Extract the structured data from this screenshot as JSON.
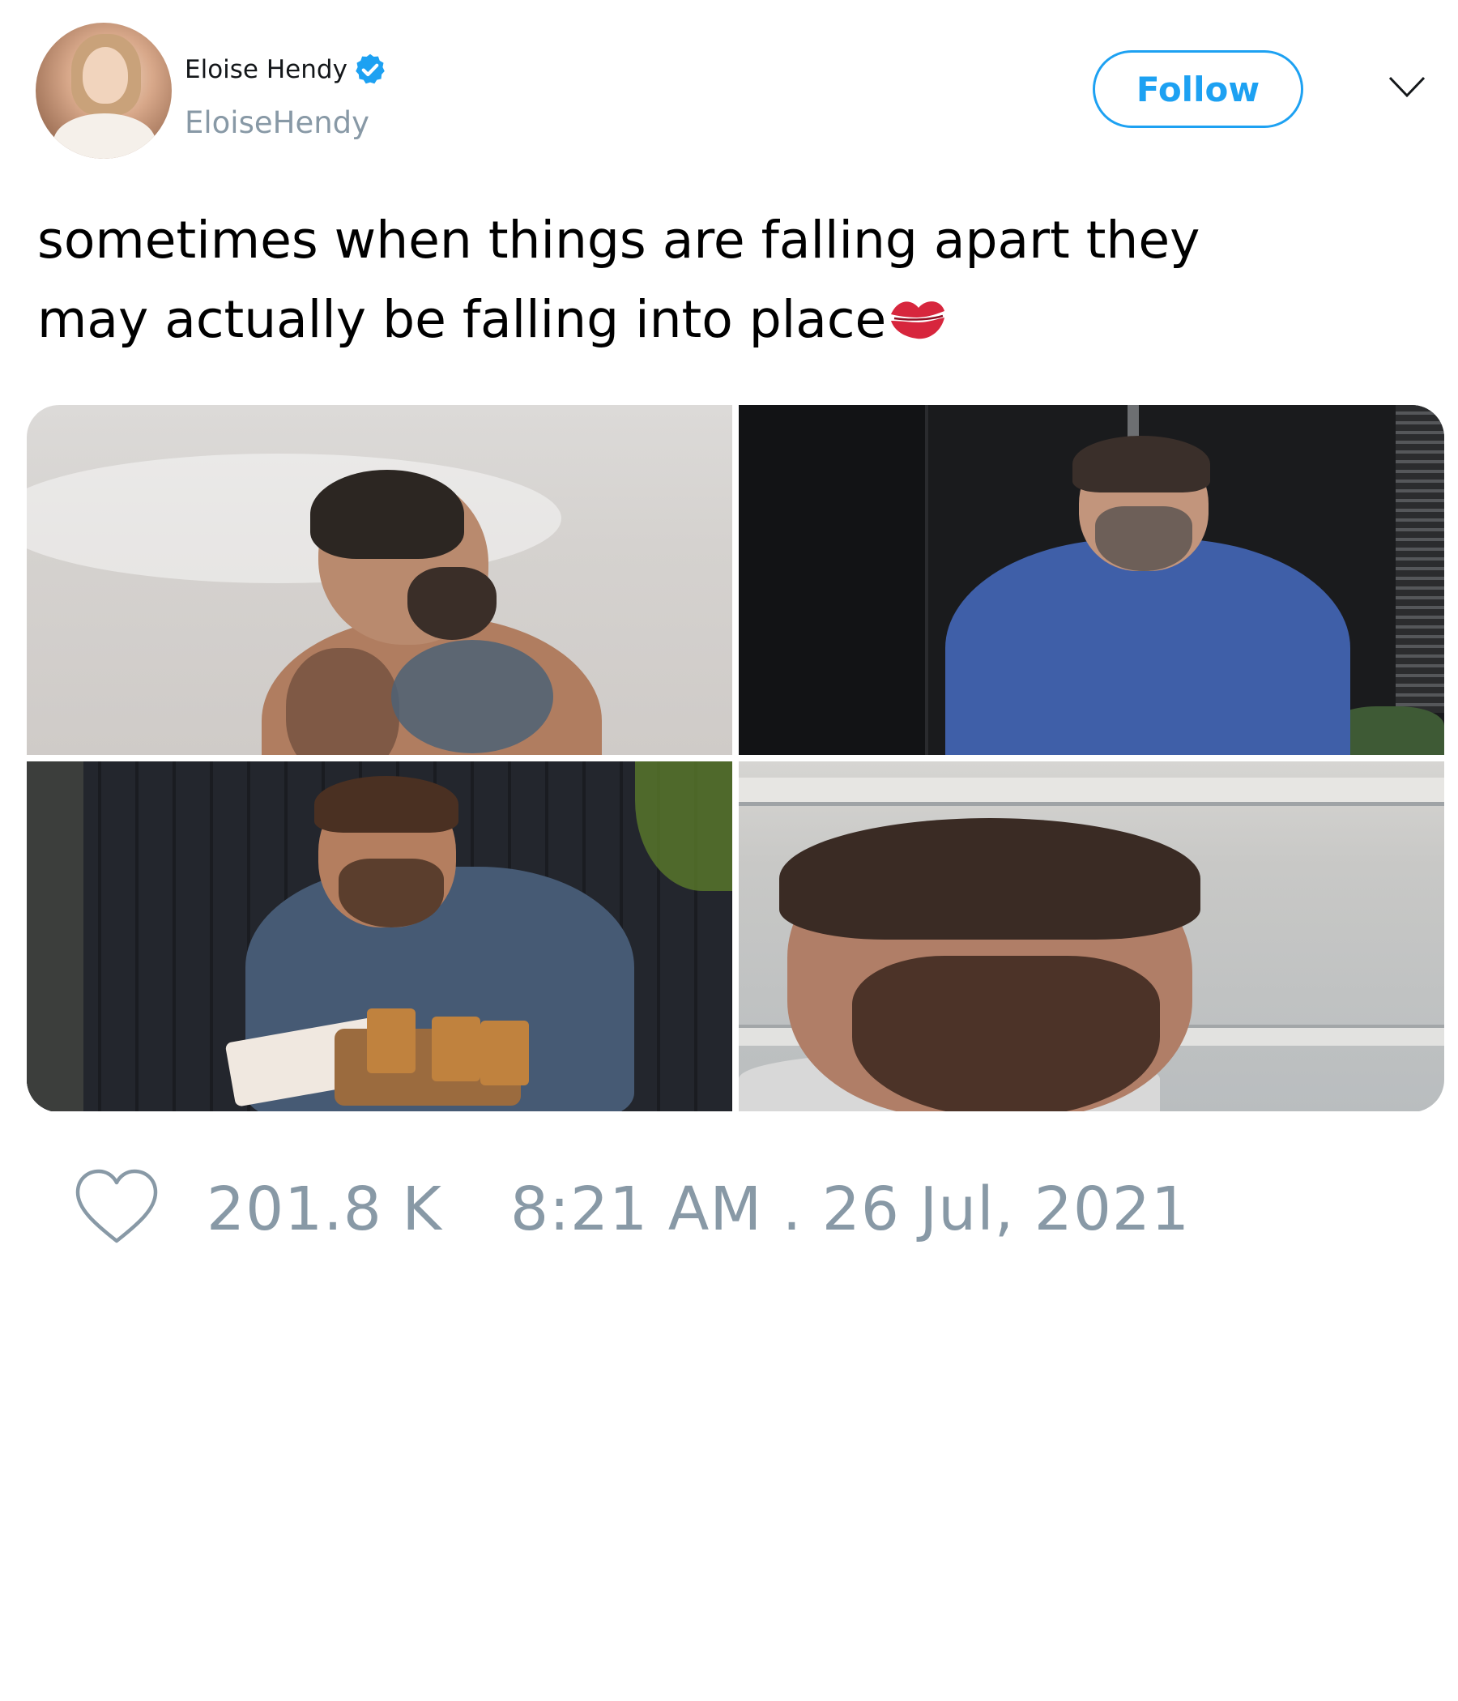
{
  "author": {
    "display_name": "Eloise Hendy",
    "handle": "EloiseHendy",
    "verified": true,
    "avatar_icon": "user-avatar"
  },
  "actions": {
    "follow_label": "Follow",
    "more_icon": "chevron-down-icon"
  },
  "tweet": {
    "text_line1": "sometimes when things are falling apart they",
    "text_line2": "may actually be falling into place",
    "emoji_icon": "kiss-mark-emoji"
  },
  "media": {
    "image_count": 4
  },
  "stats": {
    "like_icon": "heart-icon",
    "likes": "201.8 K",
    "timestamp": "8:21 AM . 26 Jul, 2021"
  },
  "colors": {
    "accent": "#1da1f2",
    "muted_text": "#8899a6",
    "emoji_red": "#d7263d"
  }
}
